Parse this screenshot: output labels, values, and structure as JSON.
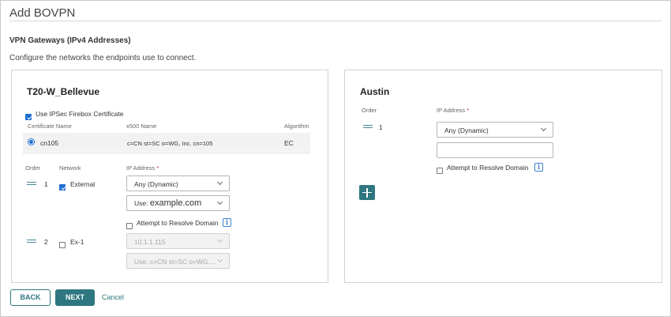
{
  "page": {
    "title": "Add BOVPN",
    "section_title": "VPN Gateways (IPv4 Addresses)",
    "section_desc": "Configure the networks the endpoints use to connect."
  },
  "left_gateway": {
    "name": "T20-W_Bellevue",
    "use_cert_label": "Use IPSec Firebox Certificate",
    "use_cert_checked": true,
    "cert_headers": {
      "name": "Certificate Name",
      "x500": "x500 Name",
      "algorithm": "Algorithm"
    },
    "cert_row": {
      "name": "cn105",
      "x500": "c=CN st=SC o=WG, Inc. cn=105",
      "algorithm": "EC",
      "selected": true
    },
    "headers": {
      "order": "Order",
      "network": "Network",
      "ip": "IP Address",
      "required": "*"
    },
    "rows": [
      {
        "order": "1",
        "network": "External",
        "checked": true,
        "ip": "Any (Dynamic)",
        "use_prefix": "Use:",
        "use_value": "example.com",
        "resolve_label": "Attempt to Resolve Domain",
        "info": "i"
      },
      {
        "order": "2",
        "network": "Ex-1",
        "checked": false,
        "ip": "10.1.1.115",
        "use_value": "Use: c=CN st=SC o=WG,..."
      }
    ]
  },
  "right_gateway": {
    "name": "Austin",
    "headers": {
      "order": "Order",
      "ip": "IP Address",
      "required": "*"
    },
    "rows": [
      {
        "order": "1",
        "ip": "Any (Dynamic)",
        "resolve_label": "Attempt to Resolve Domain",
        "info": "i"
      }
    ]
  },
  "footer": {
    "back": "BACK",
    "next": "NEXT",
    "cancel": "Cancel"
  },
  "colors": {
    "teal": "#2f7780",
    "checkbox_blue": "#1f6fd1",
    "required_red": "#c62828"
  }
}
